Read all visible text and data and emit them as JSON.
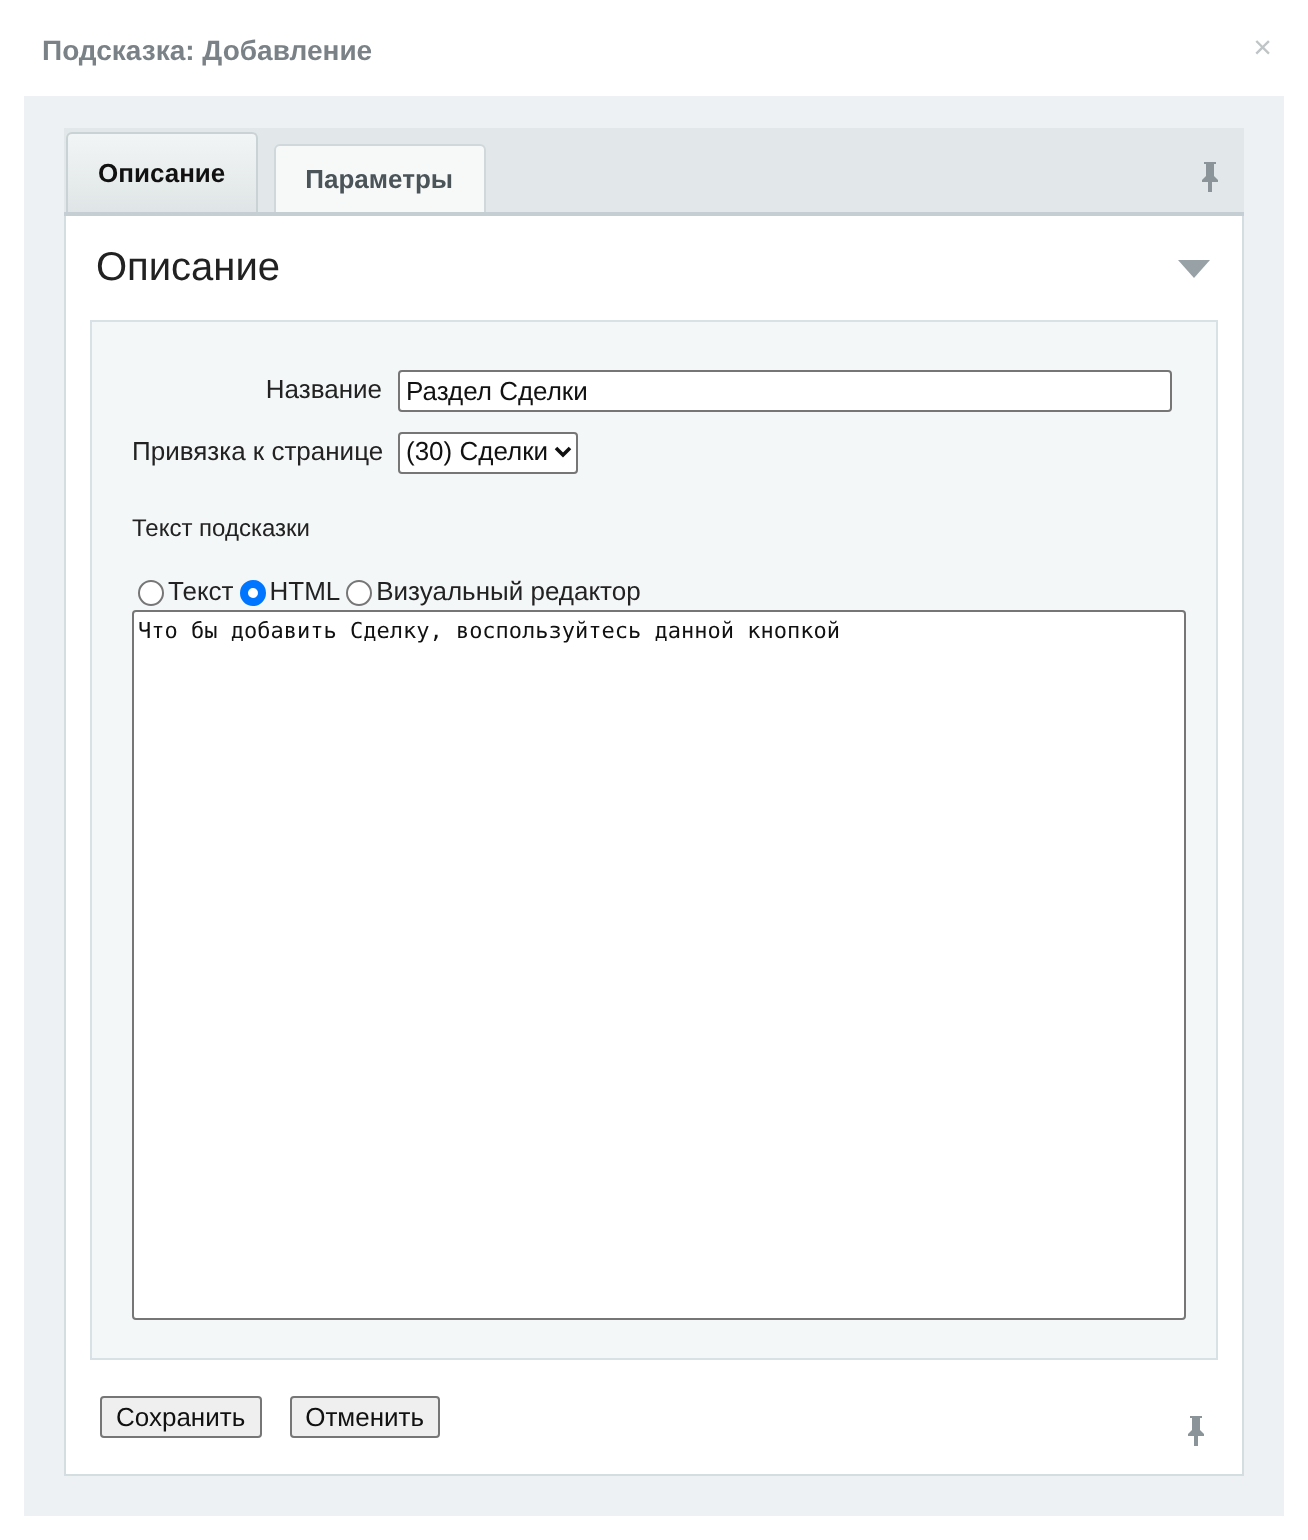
{
  "window": {
    "title": "Подсказка: Добавление",
    "close": "×"
  },
  "tabs": [
    {
      "label": "Описание",
      "selected": true
    },
    {
      "label": "Параметры",
      "selected": false
    }
  ],
  "section": {
    "title": "Описание",
    "expanded": true
  },
  "form": {
    "name_label": "Название",
    "name_value": "Раздел Сделки",
    "page_label": "Привязка к странице",
    "page_value": "(30) Сделки",
    "text_label": "Текст подсказки",
    "modes": [
      {
        "label": "Текст",
        "selected": false
      },
      {
        "label": "HTML",
        "selected": true
      },
      {
        "label": "Визуальный редактор",
        "selected": false
      }
    ],
    "text_value": "Что бы добавить Сделку, воспользуйтесь данной кнопкой"
  },
  "buttons": [
    "Сохранить",
    "Отменить"
  ]
}
